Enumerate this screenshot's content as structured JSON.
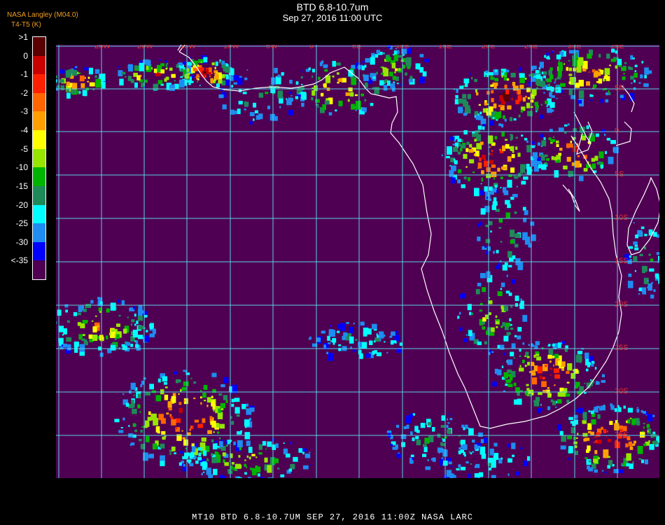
{
  "header": {
    "title": "BTD 6.8-10.7um",
    "subtitle": "Sep 27, 2016 11:00 UTC",
    "agency": "NASA Langley (M04.0)",
    "units": "T4-T5 (K)"
  },
  "legend": {
    "entries": [
      {
        "label": ">1",
        "color": "#5a0000"
      },
      {
        "label": "0",
        "color": "#c80000"
      },
      {
        "label": "-1",
        "color": "#ff2000"
      },
      {
        "label": "-2",
        "color": "#ff6600"
      },
      {
        "label": "-3",
        "color": "#ffa000"
      },
      {
        "label": "-4",
        "color": "#ffff00"
      },
      {
        "label": "-5",
        "color": "#96e600"
      },
      {
        "label": "-10",
        "color": "#00b400"
      },
      {
        "label": "-15",
        "color": "#1e8a5a"
      },
      {
        "label": "-20",
        "color": "#00ffff"
      },
      {
        "label": "-25",
        "color": "#1e8cf0"
      },
      {
        "label": "-30",
        "color": "#0000ff"
      },
      {
        "label": "<-35",
        "color": "#4f0052"
      }
    ]
  },
  "map": {
    "background_color": "#4f0052",
    "grid_color": "#5ad2e6",
    "label_color": "#e63232",
    "longitude_labels": [
      "25W",
      "20W",
      "15W",
      "10W",
      "5W",
      "0",
      "5E",
      "10E",
      "15E",
      "20E",
      "25E",
      "30E",
      "35E"
    ],
    "latitude_labels": [
      "5N",
      "0",
      "5S",
      "10S",
      "15S",
      "20S",
      "25S",
      "30S",
      "35S"
    ]
  },
  "footer": {
    "text": "MT10   BTD 6.8-10.7UM    SEP 27, 2016 11:00Z   NASA LARC"
  }
}
